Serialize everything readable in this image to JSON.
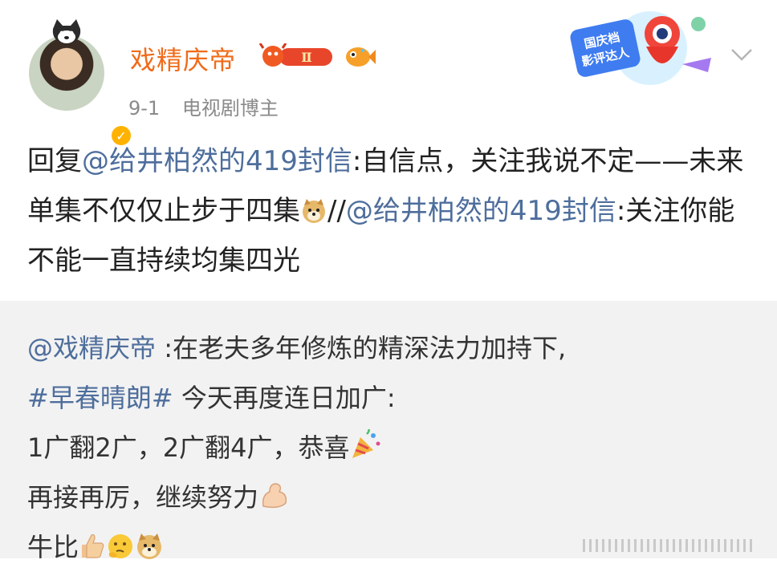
{
  "post": {
    "username": "戏精庆帝",
    "level_badge": "Ⅱ",
    "date": "9-1",
    "category": "电视剧博主",
    "festival_badge": {
      "line1": "国庆档",
      "line2": "影评达人"
    },
    "icons": [
      "dog-avatar-icon",
      "verified-icon",
      "crab-level-icon",
      "fish-icon",
      "chevron-down-icon"
    ],
    "content": {
      "prefix": "回复",
      "mention1": "@给井柏然的419封信",
      "text1": ":自信点，关注我说不定——未来单集不仅仅止步于四集",
      "separator": "//",
      "mention2": "@给井柏然的419封信",
      "text2": ":关注你能不能一直持续均集四光"
    }
  },
  "repost": {
    "mention": "@戏精庆帝",
    "line1": " :在老夫多年修炼的精深法力加持下,",
    "hashtag": "#早春晴朗#",
    "line2": " 今天再度连日加广:",
    "line3": "1广翻2广，2广翻4广，恭喜",
    "line4": "再接再厉，继续努力",
    "line5": "牛比"
  },
  "colors": {
    "username": "#f06b1a",
    "link": "#4e6e9c",
    "repost_bg": "#f2f2f2"
  }
}
